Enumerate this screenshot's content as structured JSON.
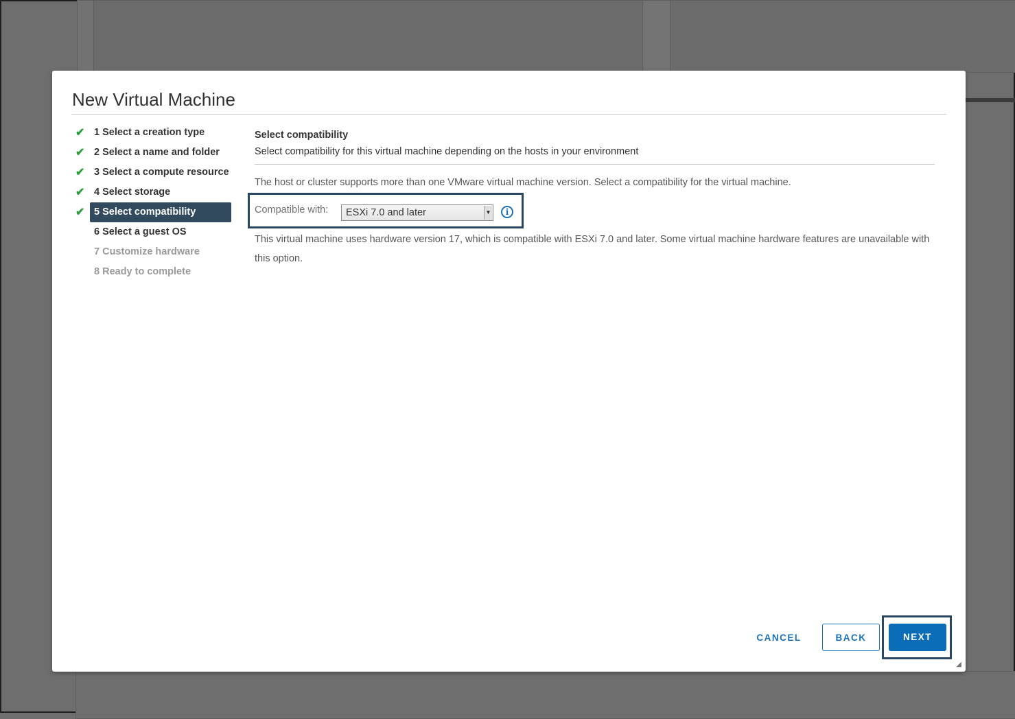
{
  "dialog": {
    "title": "New Virtual Machine"
  },
  "steps": [
    {
      "label": "1 Select a creation type",
      "done": true
    },
    {
      "label": "2 Select a name and folder",
      "done": true
    },
    {
      "label": "3 Select a compute resource",
      "done": true
    },
    {
      "label": "4 Select storage",
      "done": true
    },
    {
      "label": "5 Select compatibility",
      "done": true,
      "active": true
    },
    {
      "label": "6 Select a guest OS",
      "done": false
    },
    {
      "label": "7 Customize hardware",
      "done": false,
      "disabled": true
    },
    {
      "label": "8 Ready to complete",
      "done": false,
      "disabled": true
    }
  ],
  "content": {
    "title": "Select compatibility",
    "subtitle": "Select compatibility for this virtual machine depending on the hosts in your environment",
    "description": "The host or cluster supports more than one VMware virtual machine version. Select a compatibility for the virtual machine.",
    "compat_label": "Compatible with:",
    "compat_value": "ESXi 7.0 and later",
    "hardware_note": "This virtual machine uses hardware version 17, which is compatible with ESXi 7.0 and later. Some virtual machine hardware features are unavailable with this option."
  },
  "icons": {
    "check": "check-icon",
    "info": "info-icon",
    "dropdown": "chevron-down-icon"
  },
  "footer": {
    "cancel_label": "CANCEL",
    "back_label": "BACK",
    "next_label": "NEXT"
  },
  "colors": {
    "accent": "#0b6db7",
    "active_step": "#314a5e",
    "check": "#2f9d3e",
    "highlight_frame": "#2a4864"
  }
}
